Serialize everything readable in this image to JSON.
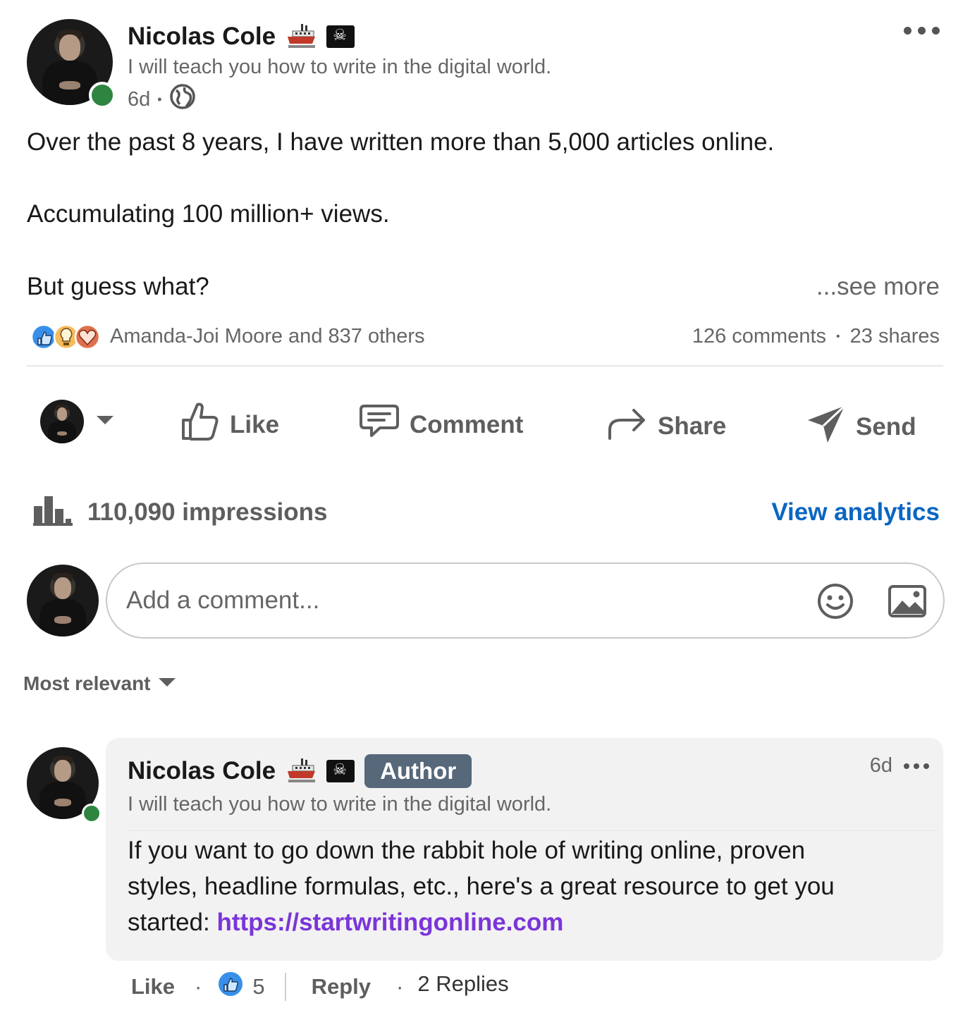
{
  "post": {
    "author_name": "Nicolas Cole",
    "author_headline": "I will teach you how to write in the digital world.",
    "time": "6d",
    "separator": "•",
    "body_lines": [
      "Over the past 8 years, I have written more than 5,000 articles online.",
      "Accumulating 100 million+ views.",
      "But guess what?"
    ],
    "see_more": "...see more",
    "reactions_text": "Amanda-Joi Moore and 837 others",
    "comments_count": "126 comments",
    "shares_count": "23 shares",
    "icons": [
      "ship-emoji-icon",
      "pirate-flag-icon",
      "globe-icon",
      "more-icon"
    ]
  },
  "actions": {
    "like": "Like",
    "comment": "Comment",
    "share": "Share",
    "send": "Send"
  },
  "analytics": {
    "impressions": "110,090 impressions",
    "view_label": "View analytics"
  },
  "composer": {
    "placeholder": "Add a comment..."
  },
  "sort": {
    "label": "Most relevant"
  },
  "comment": {
    "author_name": "Nicolas Cole",
    "badge": "Author",
    "headline": "I will teach you how to write in the digital world.",
    "time": "6d",
    "text_line1": "If you want to go down the rabbit hole of writing online, proven",
    "text_line2": "styles, headline formulas, etc., here's a great resource to get you",
    "text_line3_prefix": "started: ",
    "link": "https://startwritingonline.com",
    "like_label": "Like",
    "like_count": "5",
    "reply_label": "Reply",
    "replies_label": "2 Replies",
    "dot": "·"
  },
  "colors": {
    "accent_blue": "#0a66c2",
    "link_purple": "#7a35d9",
    "online_green": "#2e8540",
    "badge_gray": "#56687a"
  }
}
